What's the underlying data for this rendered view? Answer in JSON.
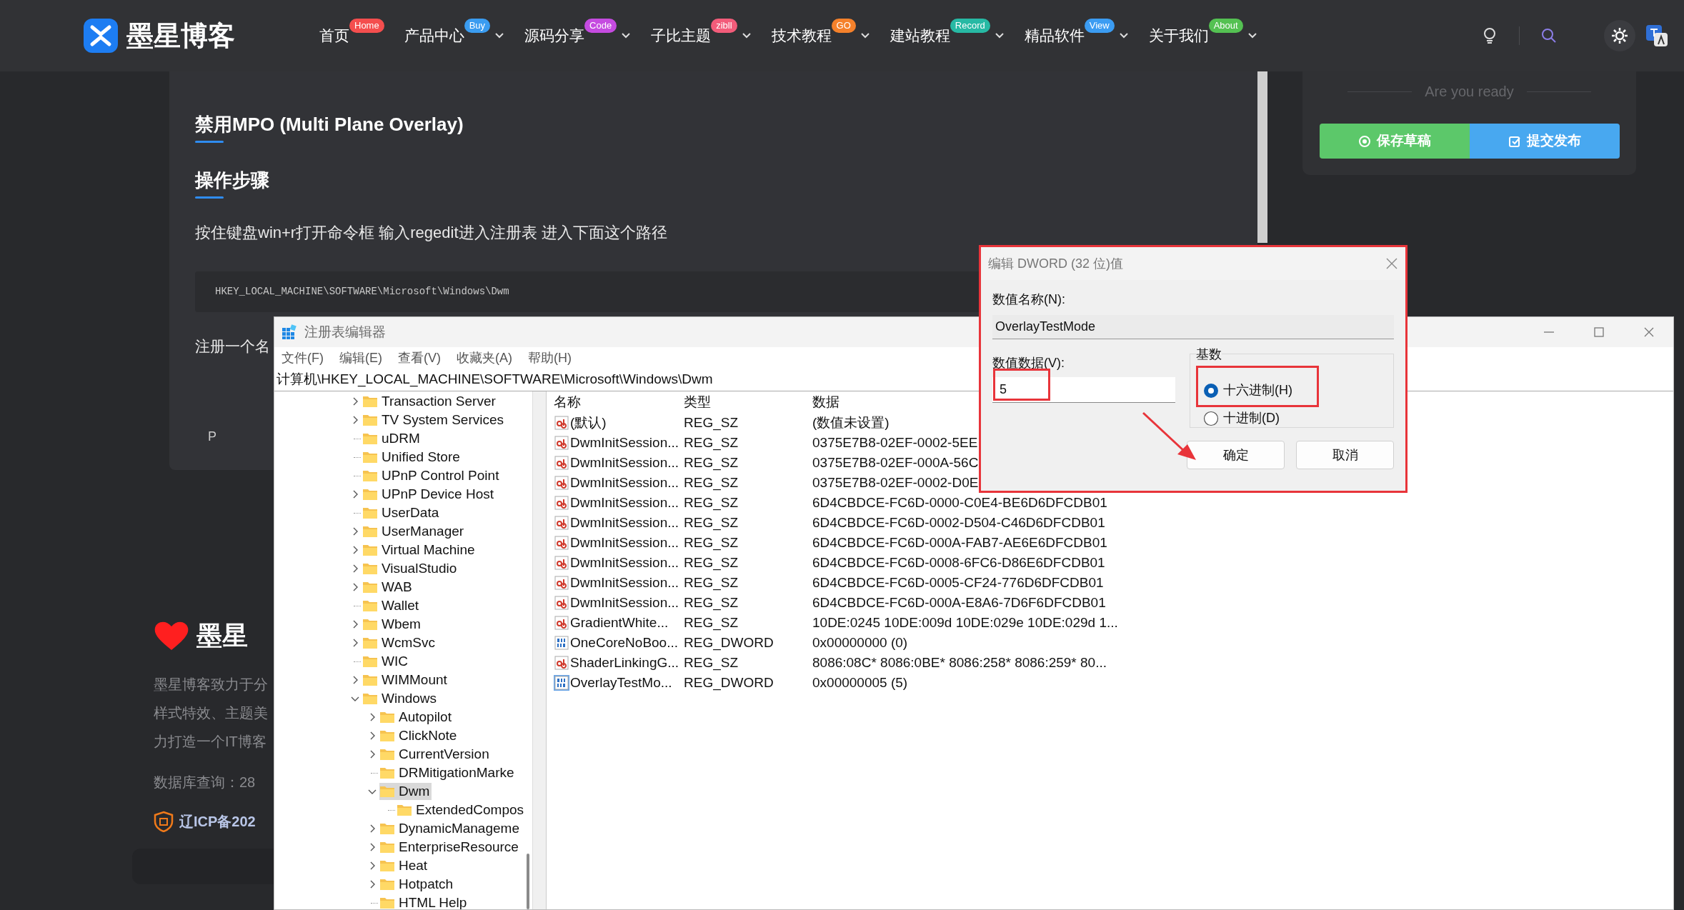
{
  "nav": {
    "brand": "墨星博客",
    "items": [
      {
        "label": "首页",
        "badge": "Home",
        "color": "#f44e4e",
        "dropdown": false
      },
      {
        "label": "产品中心",
        "badge": "Buy",
        "color": "#3a9cf0",
        "dropdown": true
      },
      {
        "label": "源码分享",
        "badge": "Code",
        "color": "#c54be0",
        "dropdown": true
      },
      {
        "label": "子比主题",
        "badge": "zibll",
        "color": "#f35c7a",
        "dropdown": true
      },
      {
        "label": "技术教程",
        "badge": "GO",
        "color": "#f5812b",
        "dropdown": true
      },
      {
        "label": "建站教程",
        "badge": "Record",
        "color": "#27b9a4",
        "dropdown": true
      },
      {
        "label": "精品软件",
        "badge": "View",
        "color": "#3b9cf2",
        "dropdown": true
      },
      {
        "label": "关于我们",
        "badge": "About",
        "color": "#54c152",
        "dropdown": true
      }
    ]
  },
  "article": {
    "blocks": [
      {
        "kind": "heading",
        "text": "禁用MPO (Multi Plane Overlay)"
      },
      {
        "kind": "heading",
        "text": "操作步骤"
      },
      {
        "kind": "paragraph",
        "text": "按住键盘win+r打开命令框 输入regedit进入注册表 进入下面这个路径"
      },
      {
        "kind": "code",
        "text": "HKEY_LOCAL_MACHINE\\SOFTWARE\\Microsoft\\Windows\\Dwm"
      },
      {
        "kind": "paragraph",
        "text": "注册一个名"
      },
      {
        "kind": "note",
        "text": "P"
      }
    ]
  },
  "sidebar": {
    "hint": "Are you ready",
    "buttons": [
      {
        "label": "保存草稿",
        "color": "#5cc86a"
      },
      {
        "label": "提交发布",
        "color": "#48a8f0"
      }
    ]
  },
  "footer": {
    "title": "墨星",
    "lines": [
      "墨星博客致力于分",
      "样式特效、主题美",
      "力打造一个IT博客"
    ],
    "stats": "数据库查询：28",
    "icp": "辽ICP备202"
  },
  "regedit": {
    "title": "注册表编辑器",
    "menu": [
      "文件(F)",
      "编辑(E)",
      "查看(V)",
      "收藏夹(A)",
      "帮助(H)"
    ],
    "address": "计算机\\HKEY_LOCAL_MACHINE\\SOFTWARE\\Microsoft\\Windows\\Dwm",
    "tree": [
      {
        "label": "Transaction Server",
        "expandable": true,
        "expanded": false,
        "selected": false
      },
      {
        "label": "TV System Services",
        "expandable": true,
        "expanded": false,
        "selected": false
      },
      {
        "label": "uDRM",
        "expandable": false,
        "selected": false
      },
      {
        "label": "Unified Store",
        "expandable": false,
        "selected": false
      },
      {
        "label": "UPnP Control Point",
        "expandable": false,
        "selected": false
      },
      {
        "label": "UPnP Device Host",
        "expandable": true,
        "expanded": false,
        "selected": false
      },
      {
        "label": "UserData",
        "expandable": false,
        "selected": false
      },
      {
        "label": "UserManager",
        "expandable": true,
        "expanded": false,
        "selected": false
      },
      {
        "label": "Virtual Machine",
        "expandable": true,
        "expanded": false,
        "selected": false
      },
      {
        "label": "VisualStudio",
        "expandable": true,
        "expanded": false,
        "selected": false
      },
      {
        "label": "WAB",
        "expandable": true,
        "expanded": false,
        "selected": false
      },
      {
        "label": "Wallet",
        "expandable": false,
        "selected": false
      },
      {
        "label": "Wbem",
        "expandable": true,
        "expanded": false,
        "selected": false
      },
      {
        "label": "WcmSvc",
        "expandable": true,
        "expanded": false,
        "selected": false
      },
      {
        "label": "WIC",
        "expandable": false,
        "selected": false
      },
      {
        "label": "WIMMount",
        "expandable": true,
        "expanded": false,
        "selected": false
      },
      {
        "label": "Windows",
        "expandable": true,
        "expanded": true,
        "selected": false,
        "children": [
          {
            "label": "Autopilot",
            "expandable": true,
            "expanded": false,
            "selected": false
          },
          {
            "label": "ClickNote",
            "expandable": true,
            "expanded": false,
            "selected": false
          },
          {
            "label": "CurrentVersion",
            "expandable": true,
            "expanded": false,
            "selected": false
          },
          {
            "label": "DRMitigationMarke",
            "expandable": false,
            "selected": false
          },
          {
            "label": "Dwm",
            "expandable": true,
            "expanded": true,
            "selected": true,
            "children": [
              {
                "label": "ExtendedCompos",
                "expandable": false,
                "selected": false
              }
            ]
          },
          {
            "label": "DynamicManageme",
            "expandable": true,
            "expanded": false,
            "selected": false
          },
          {
            "label": "EnterpriseResource",
            "expandable": true,
            "expanded": false,
            "selected": false
          },
          {
            "label": "Heat",
            "expandable": true,
            "expanded": false,
            "selected": false
          },
          {
            "label": "Hotpatch",
            "expandable": true,
            "expanded": false,
            "selected": false
          },
          {
            "label": "HTML Help",
            "expandable": false,
            "selected": false
          }
        ]
      }
    ],
    "columns": [
      "名称",
      "类型",
      "数据"
    ],
    "rows": [
      {
        "kind": "string",
        "name": "(默认)",
        "type": "REG_SZ",
        "data": "(数值未设置)",
        "selected": false
      },
      {
        "kind": "string",
        "name": "DwmInitSession...",
        "type": "REG_SZ",
        "data": "0375E7B8-02EF-0002-5EE",
        "selected": false
      },
      {
        "kind": "string",
        "name": "DwmInitSession...",
        "type": "REG_SZ",
        "data": "0375E7B8-02EF-000A-56C",
        "selected": false
      },
      {
        "kind": "string",
        "name": "DwmInitSession...",
        "type": "REG_SZ",
        "data": "0375E7B8-02EF-0002-D0E",
        "selected": false
      },
      {
        "kind": "string",
        "name": "DwmInitSession...",
        "type": "REG_SZ",
        "data": "6D4CBDCE-FC6D-0000-C0E4-BE6D6DFCDB01",
        "selected": false
      },
      {
        "kind": "string",
        "name": "DwmInitSession...",
        "type": "REG_SZ",
        "data": "6D4CBDCE-FC6D-0002-D504-C46D6DFCDB01",
        "selected": false
      },
      {
        "kind": "string",
        "name": "DwmInitSession...",
        "type": "REG_SZ",
        "data": "6D4CBDCE-FC6D-000A-FAB7-AE6E6DFCDB01",
        "selected": false
      },
      {
        "kind": "string",
        "name": "DwmInitSession...",
        "type": "REG_SZ",
        "data": "6D4CBDCE-FC6D-0008-6FC6-D86E6DFCDB01",
        "selected": false
      },
      {
        "kind": "string",
        "name": "DwmInitSession...",
        "type": "REG_SZ",
        "data": "6D4CBDCE-FC6D-0005-CF24-776D6DFCDB01",
        "selected": false
      },
      {
        "kind": "string",
        "name": "DwmInitSession...",
        "type": "REG_SZ",
        "data": "6D4CBDCE-FC6D-000A-E8A6-7D6F6DFCDB01",
        "selected": false
      },
      {
        "kind": "string",
        "name": "GradientWhite...",
        "type": "REG_SZ",
        "data": "10DE:0245 10DE:009d 10DE:029e 10DE:029d 1...",
        "selected": false
      },
      {
        "kind": "dword",
        "name": "OneCoreNoBoo...",
        "type": "REG_DWORD",
        "data": "0x00000000 (0)",
        "selected": false
      },
      {
        "kind": "string",
        "name": "ShaderLinkingG...",
        "type": "REG_SZ",
        "data": "8086:08C* 8086:0BE* 8086:258* 8086:259* 80...",
        "selected": false
      },
      {
        "kind": "dword",
        "name": "OverlayTestMo...",
        "type": "REG_DWORD",
        "data": "0x00000005 (5)",
        "selected": true
      }
    ]
  },
  "dialog": {
    "title": "编辑 DWORD (32 位)值",
    "name_label": "数值名称(N):",
    "name_value": "OverlayTestMode",
    "data_label": "数值数据(V):",
    "data_value": "5",
    "base_label": "基数",
    "radios": [
      {
        "label": "十六进制(H)",
        "selected": true
      },
      {
        "label": "十进制(D)",
        "selected": false
      }
    ],
    "buttons": [
      "确定",
      "取消"
    ]
  }
}
